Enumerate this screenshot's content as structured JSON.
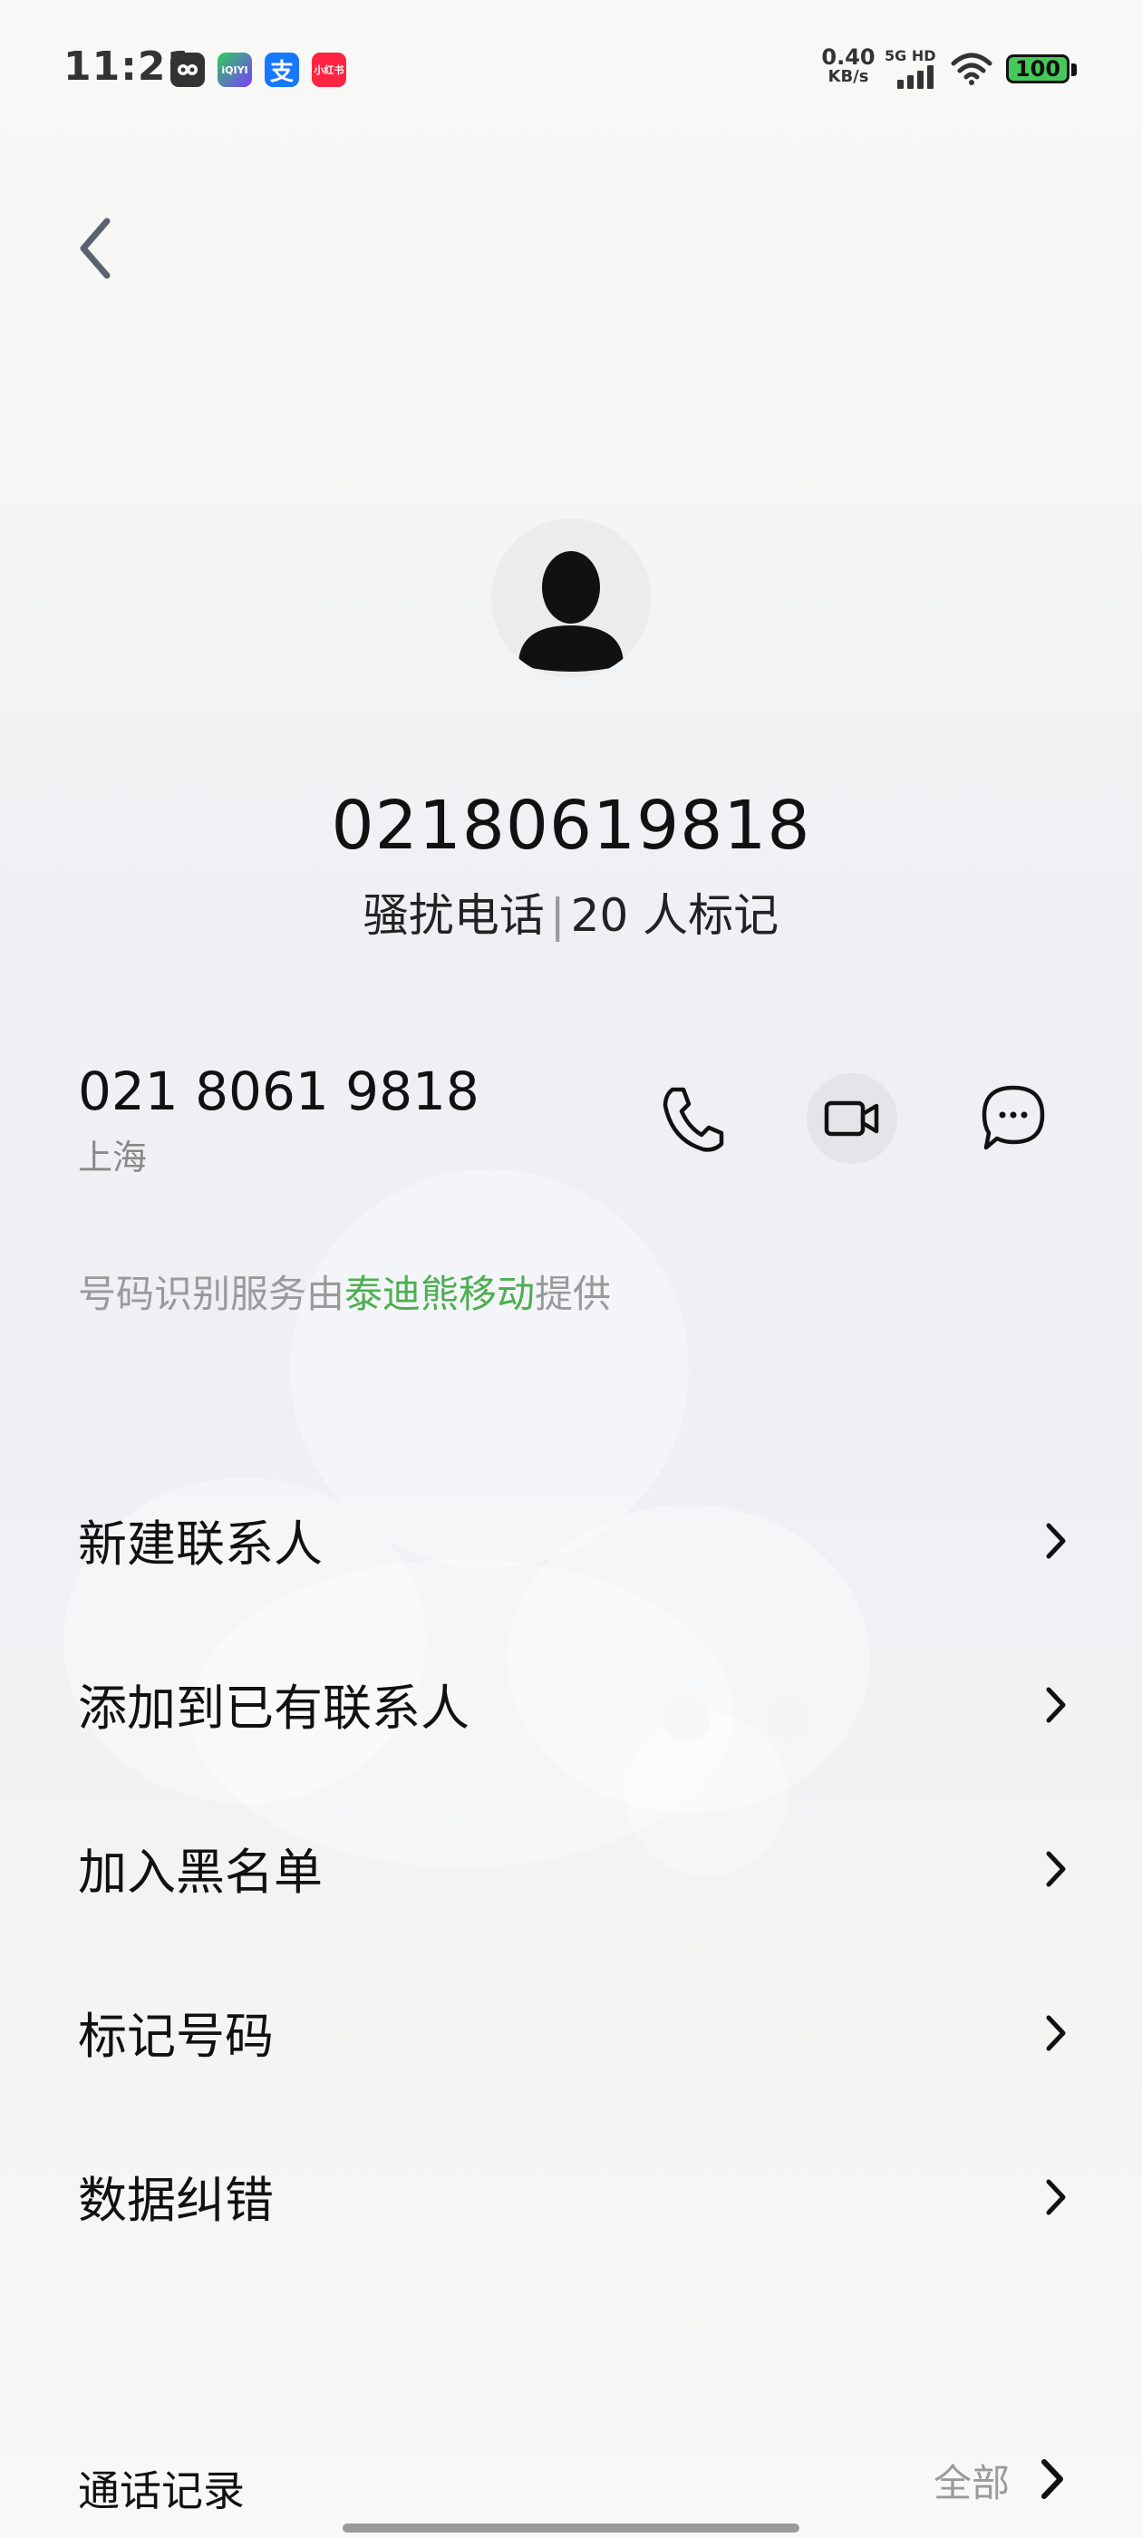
{
  "status_bar": {
    "time": "11:21",
    "app_icons": [
      {
        "name": "owl-app-icon",
        "label": "",
        "color": "#333333"
      },
      {
        "name": "iqiyi-app-icon",
        "label": "iQIYI",
        "color": "#2ccf5a"
      },
      {
        "name": "alipay-app-icon",
        "label": "支",
        "color": "#1677ff"
      },
      {
        "name": "xiaohongshu-app-icon",
        "label": "小红书",
        "color": "#ff2442"
      }
    ],
    "net_speed_value": "0.40",
    "net_speed_unit": "KB/s",
    "network_tag": "5G HD",
    "battery": "100",
    "battery_color": "#47c95a"
  },
  "header": {
    "back_icon": "chevron-left-icon"
  },
  "contact": {
    "title_number": "02180619818",
    "label": "骚扰电话",
    "separator": "|",
    "mark_count": "20 人标记",
    "formatted_number": "021 8061 9818",
    "location": "上海"
  },
  "actions": {
    "call_icon": "phone-icon",
    "video_icon": "video-camera-icon",
    "message_icon": "message-bubble-icon"
  },
  "provider": {
    "prefix": "号码识别服务由",
    "name": "泰迪熊移动",
    "suffix": "提供",
    "highlight_color": "#4caf50"
  },
  "menu": [
    {
      "label": "新建联系人"
    },
    {
      "label": "添加到已有联系人"
    },
    {
      "label": "加入黑名单"
    },
    {
      "label": "标记号码"
    },
    {
      "label": "数据纠错"
    }
  ],
  "call_log": {
    "title": "通话记录",
    "all_label": "全部"
  }
}
